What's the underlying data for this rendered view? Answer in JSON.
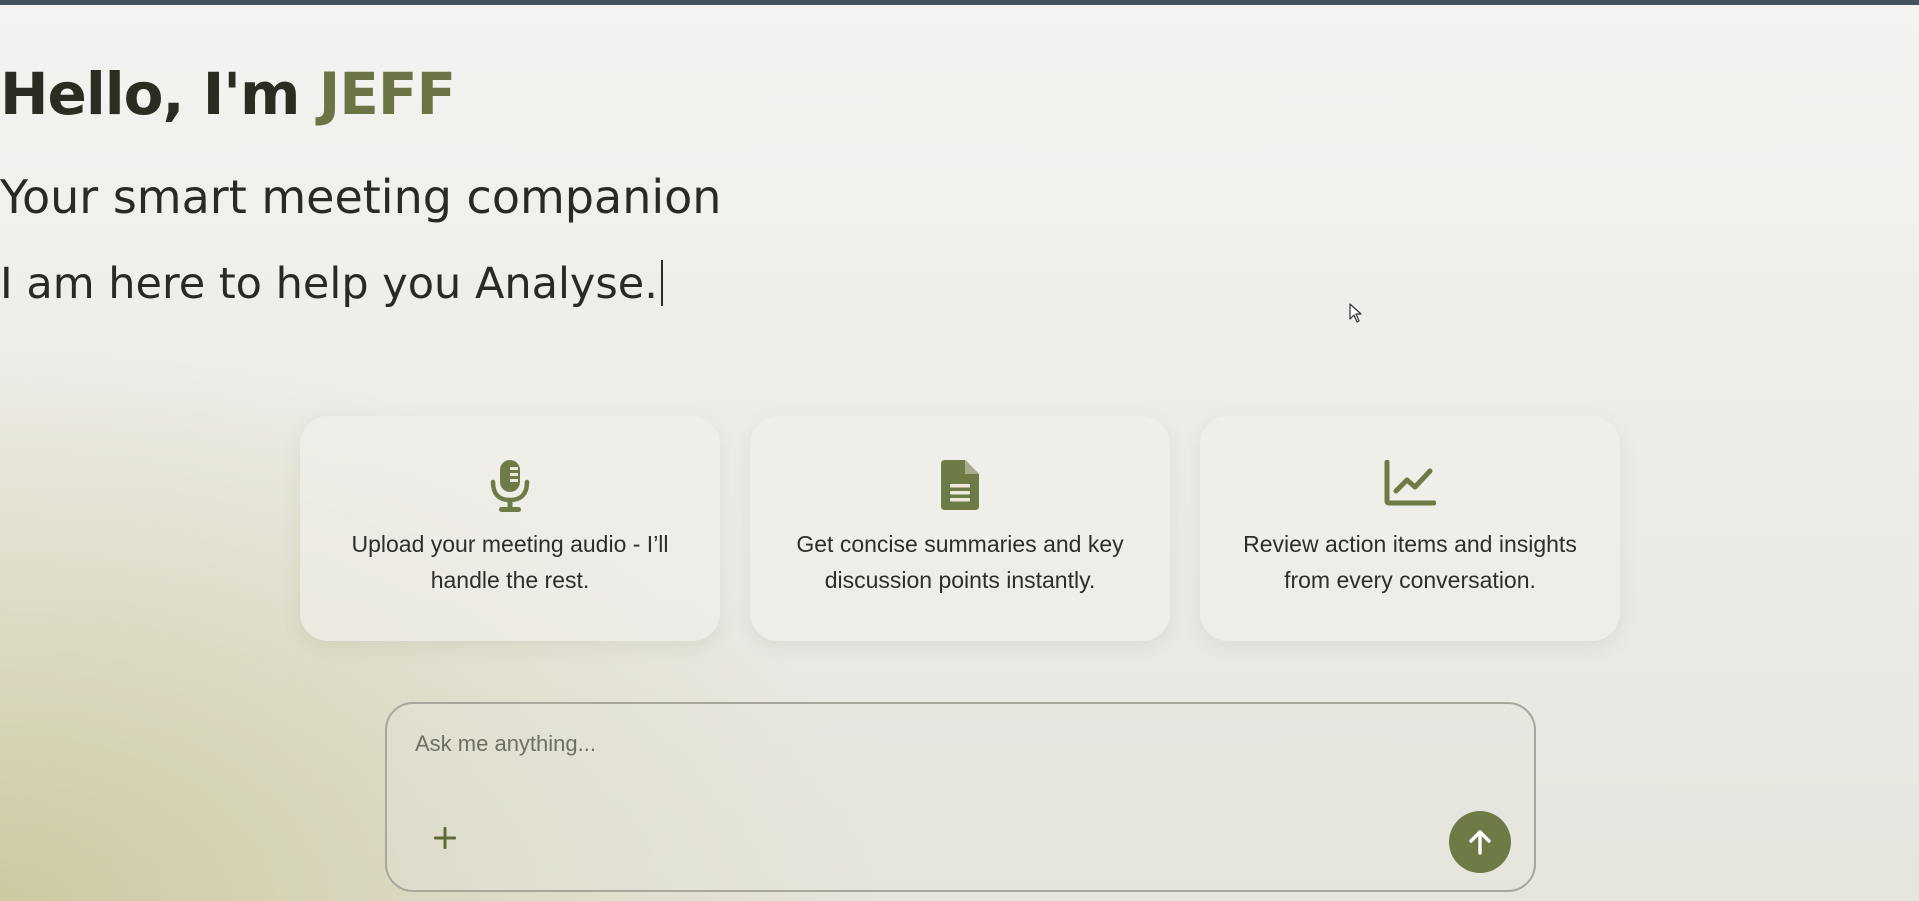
{
  "header": {
    "greeting": "Hello, I'm ",
    "name": "JEFF",
    "subtitle": "Your smart meeting companion",
    "typing_text": "I am here to help you Analyse."
  },
  "features": [
    {
      "icon": "microphone-icon",
      "text": "Upload your meeting audio - I’ll handle the rest."
    },
    {
      "icon": "document-icon",
      "text": "Get concise summaries and key discussion points instantly."
    },
    {
      "icon": "line-chart-icon",
      "text": "Review action items and insights from every conversation."
    }
  ],
  "chat": {
    "placeholder": "Ask me anything...",
    "value": "",
    "add_icon": "plus-icon",
    "send_icon": "arrow-up-icon"
  },
  "colors": {
    "accent": "#6b7444",
    "send_button": "#6f7b46",
    "top_bar": "#46525b",
    "text_dark": "#2c2c22"
  }
}
